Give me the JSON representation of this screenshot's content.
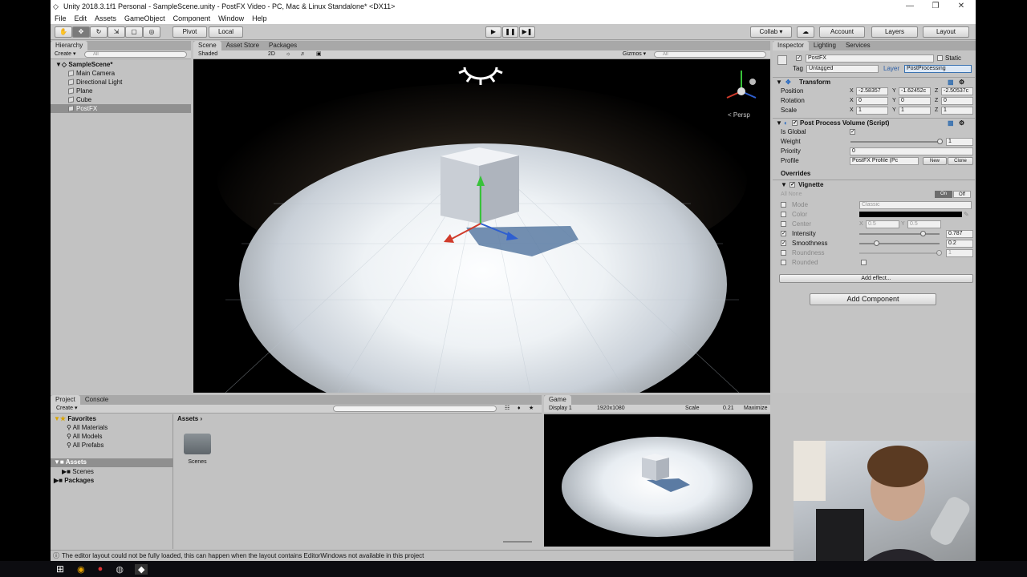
{
  "window": {
    "title": "Unity 2018.3.1f1 Personal - SampleScene.unity - PostFX Video - PC, Mac & Linux Standalone* <DX11>",
    "minimize": "—",
    "maximize": "❐",
    "close": "✕"
  },
  "menu": [
    "File",
    "Edit",
    "Assets",
    "GameObject",
    "Component",
    "Window",
    "Help"
  ],
  "toolbar": {
    "pivot": "Pivot",
    "local": "Local",
    "collab": "Collab ▾",
    "account": "Account",
    "layers": "Layers",
    "layout": "Layout"
  },
  "hierarchy": {
    "tab": "Hierarchy",
    "create": "Create ▾",
    "search_placeholder": "All",
    "scene": "SampleScene*",
    "items": [
      "Main Camera",
      "Directional Light",
      "Plane",
      "Cube",
      "PostFX"
    ]
  },
  "scene": {
    "tabs": [
      "Scene",
      "Asset Store",
      "Packages"
    ],
    "shading": "Shaded",
    "mode2d": "2D",
    "gizmos": "Gizmos ▾",
    "search_placeholder": "All",
    "persp": "< Persp"
  },
  "inspector": {
    "tabs": [
      "Inspector",
      "Lighting",
      "Services"
    ],
    "object_name": "PostFX",
    "static": "Static",
    "tag_label": "Tag",
    "tag_value": "Untagged",
    "layer_label": "Layer",
    "layer_value": "PostProcessing",
    "transform": {
      "title": "Transform",
      "position_label": "Position",
      "rotation_label": "Rotation",
      "scale_label": "Scale",
      "px": "-2.58357",
      "py": "-1.62452с",
      "pz": "-2.50537с",
      "rx": "0",
      "ry": "0",
      "rz": "0",
      "sx": "1",
      "sy": "1",
      "sz": "1"
    },
    "ppv": {
      "title": "Post Process Volume (Script)",
      "is_global": "Is Global",
      "weight_label": "Weight",
      "weight": "1",
      "weight_level": 1,
      "priority_label": "Priority",
      "priority": "0",
      "profile_label": "Profile",
      "profile": "PostFX Profile (Pc",
      "new": "New",
      "clone": "Clone",
      "overrides": "Overrides",
      "vignette": "Vignette",
      "all_none": "All None",
      "on": "On",
      "off": "Off",
      "mode_label": "Mode",
      "mode": "Classic",
      "color_label": "Color",
      "center_label": "Center",
      "center_x": "0.5",
      "center_y": "0.5",
      "intensity_label": "Intensity",
      "intensity": "0.787",
      "smoothness_label": "Smoothness",
      "smoothness": "0.2",
      "roundness_label": "Roundness",
      "roundness": "1",
      "rounded_label": "Rounded",
      "add_effect": "Add effect..."
    },
    "add_component": "Add Component"
  },
  "project": {
    "tabs": [
      "Project",
      "Console"
    ],
    "create": "Create ▾",
    "favorites": "Favorites",
    "fav_items": [
      "All Materials",
      "All Models",
      "All Prefabs"
    ],
    "assets": "Assets",
    "assets_items": [
      "Scenes"
    ],
    "packages": "Packages",
    "breadcrumb": "Assets",
    "folder": "Scenes"
  },
  "game": {
    "tab": "Game",
    "display": "Display 1",
    "resolution": "1920x1080",
    "scale_label": "Scale",
    "scale": "0.21",
    "maximize": "Maximize"
  },
  "status": "The editor layout could not be fully loaded, this can happen when the layout contains EditorWindows not available in this project",
  "colors": {
    "accent": "#3a72b0",
    "selection": "#8f8f8f"
  }
}
